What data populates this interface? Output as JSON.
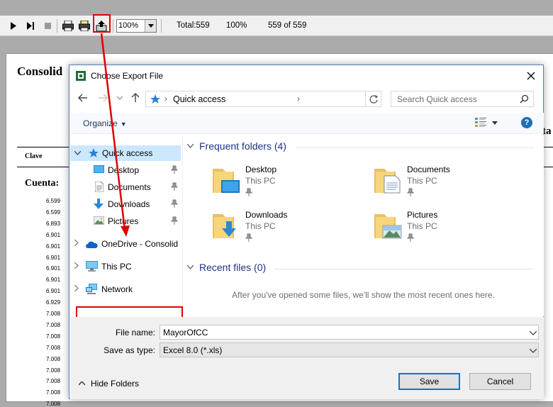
{
  "toolbar": {
    "zoom_value": "100%",
    "total_label": "Total:559",
    "percent": "100%",
    "page_count": "559 of 559"
  },
  "report": {
    "title": "Consolid",
    "partial_header": "ta",
    "clave_label": "Clave",
    "cuenta_label": "Cuenta:",
    "account_numbers": [
      "6.599",
      "6.599",
      "6.893",
      "6.901",
      "6.901",
      "6.901",
      "6.901",
      "6.901",
      "6.901",
      "6.929",
      "7.008",
      "7.008",
      "7.008",
      "7.008",
      "7.008",
      "7.008",
      "7.008",
      "7.008",
      "7.008"
    ]
  },
  "dialog": {
    "title": "Choose Export File",
    "address_location": "Quick access",
    "search_placeholder": "Search Quick access",
    "organize_label": "Organize",
    "nav_items": [
      {
        "label": "Quick access"
      },
      {
        "label": "Desktop"
      },
      {
        "label": "Documents"
      },
      {
        "label": "Downloads"
      },
      {
        "label": "Pictures"
      },
      {
        "label": "OneDrive - Consolid"
      },
      {
        "label": "This PC"
      },
      {
        "label": "Network"
      }
    ],
    "frequent_header": "Frequent folders (4)",
    "folders": [
      {
        "name": "Desktop",
        "location": "This PC",
        "icon": "desktop-folder-icon"
      },
      {
        "name": "Documents",
        "location": "This PC",
        "icon": "documents-folder-icon"
      },
      {
        "name": "Downloads",
        "location": "This PC",
        "icon": "downloads-folder-icon"
      },
      {
        "name": "Pictures",
        "location": "This PC",
        "icon": "pictures-folder-icon"
      }
    ],
    "recent_header": "Recent files (0)",
    "empty_message": "After you've opened some files, we'll show the most recent ones here.",
    "file_name_label": "File name:",
    "file_name_value": "MayorOfCC",
    "save_type_label": "Save as type:",
    "save_type_value": "Excel 8.0 (*.xls)",
    "hide_folders_label": "Hide Folders",
    "save_button": "Save",
    "cancel_button": "Cancel"
  },
  "colors": {
    "annotation_red": "#e00000",
    "selection_blue": "#cce8ff",
    "link_blue": "#1e3287",
    "accent": "#0078d7"
  }
}
